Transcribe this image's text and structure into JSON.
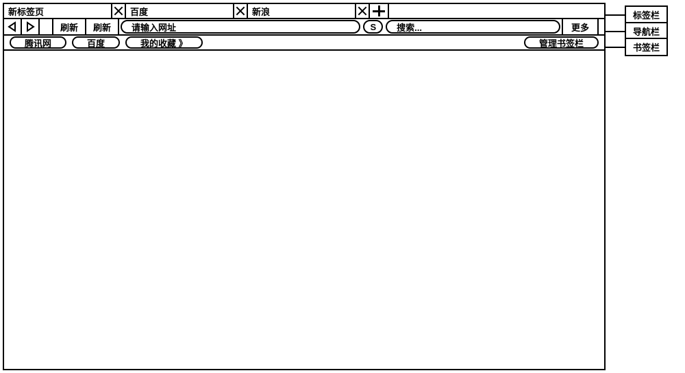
{
  "tabs": [
    {
      "title": "新标签页"
    },
    {
      "title": "百度"
    },
    {
      "title": "新浪"
    }
  ],
  "nav": {
    "refresh1": "刷新",
    "refresh2": "刷新",
    "url_placeholder": "请输入网址",
    "search_badge": "S",
    "search_placeholder": "搜索...",
    "more": "更多"
  },
  "bookmarks": {
    "items": [
      "腾讯网",
      "百度",
      "我的收藏 》"
    ],
    "manage": "管理书签栏"
  },
  "callouts": {
    "tabs": "标签栏",
    "nav": "导航栏",
    "bookmarks": "书签栏"
  }
}
